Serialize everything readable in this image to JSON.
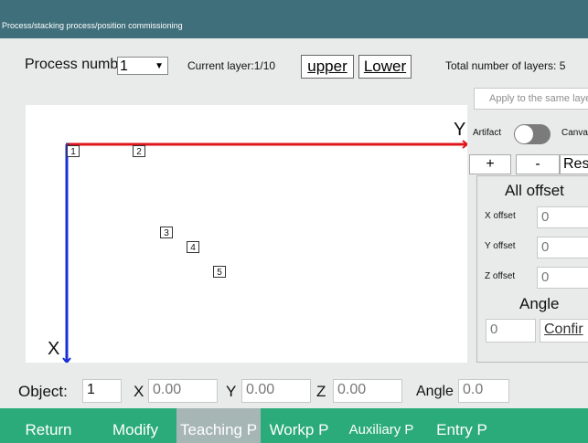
{
  "header": {
    "breadcrumb": "Process/stacking process/position commissioning"
  },
  "toolbar": {
    "process_number_label": "Process numbe",
    "process_number_value": "1",
    "current_layer": "Current layer:1/10",
    "upper_label": "upper",
    "lower_label": "Lower",
    "total_layers": "Total number of layers: 5"
  },
  "side": {
    "apply_same_layer": "Apply to the same laye",
    "artifact_label": "Artifact",
    "canvas_label": "Canva",
    "toggle_on": false,
    "plus_label": "+",
    "minus_label": "-",
    "reset_label": "Res",
    "all_offset_title": "All offset",
    "x_offset_label": "X offset",
    "x_offset_value": "0",
    "y_offset_label": "Y offset",
    "y_offset_value": "0",
    "z_offset_label": "Z offset",
    "z_offset_value": "0",
    "angle_title": "Angle",
    "angle_value": "0",
    "confirm_label": "Confir"
  },
  "canvas": {
    "y_axis_label": "Y",
    "x_axis_label": "X",
    "points": [
      "1",
      "2",
      "3",
      "4",
      "5"
    ]
  },
  "object_row": {
    "object_label": "Object:",
    "object_value": "1",
    "x_label": "X",
    "x_value": "0.00",
    "y_label": "Y",
    "y_value": "0.00",
    "z_label": "Z",
    "z_value": "0.00",
    "angle_label": "Angle",
    "angle_value": "0.0"
  },
  "tabs": [
    {
      "label": "Return",
      "active": false
    },
    {
      "label": "Modify",
      "active": false
    },
    {
      "label": "Teaching P",
      "active": true
    },
    {
      "label": "Workp P",
      "active": false
    },
    {
      "label": "Auxiliary P",
      "active": false
    },
    {
      "label": "Entry P",
      "active": false
    }
  ],
  "colors": {
    "titlebar": "#3f6f7b",
    "tabbar": "#2bab7a",
    "active_tab": "#a6b6b4",
    "y_axis": "#e0151b",
    "x_axis": "#1b2fd6"
  }
}
